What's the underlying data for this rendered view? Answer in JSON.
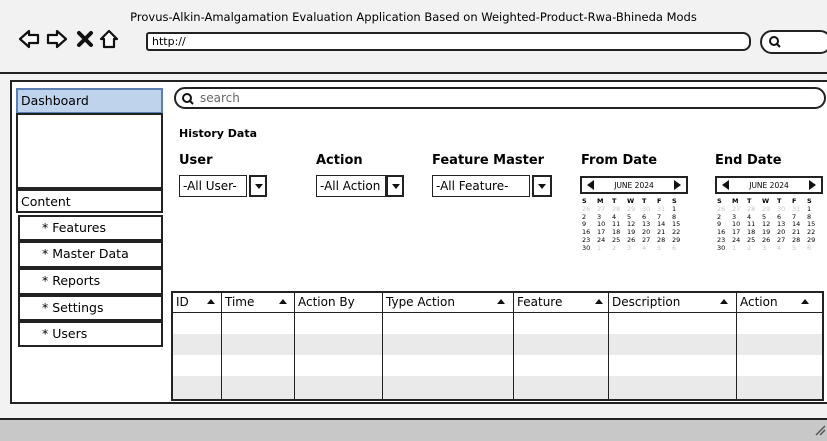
{
  "window": {
    "title": "Provus-Alkin-Amalgamation Evaluation Application Based on Weighted-Product-Rwa-Bhineda Mods",
    "url": "http://"
  },
  "sidebar": {
    "dashboard": "Dashboard",
    "content": "Content",
    "items": [
      "* Features",
      "* Master Data",
      "* Reports",
      "* Settings",
      "* Users"
    ]
  },
  "search": {
    "placeholder": "search"
  },
  "history": {
    "title": "History Data",
    "filters": {
      "user": {
        "label": "User",
        "value": "-All User-"
      },
      "action": {
        "label": "Action",
        "value": "-All Action"
      },
      "feature": {
        "label": "Feature Master",
        "value": "-All Feature-"
      },
      "from_date": {
        "label": "From Date"
      },
      "end_date": {
        "label": "End Date"
      }
    }
  },
  "calendar": {
    "month": "JUNE 2024",
    "weekdays": [
      "S",
      "M",
      "T",
      "W",
      "T",
      "F",
      "S"
    ],
    "days": [
      [
        "26",
        "27",
        "28",
        "29",
        "30",
        "31",
        "1"
      ],
      [
        "2",
        "3",
        "4",
        "5",
        "6",
        "7",
        "8"
      ],
      [
        "9",
        "10",
        "11",
        "12",
        "13",
        "14",
        "15"
      ],
      [
        "16",
        "17",
        "18",
        "19",
        "20",
        "21",
        "22"
      ],
      [
        "23",
        "24",
        "25",
        "26",
        "27",
        "28",
        "29"
      ],
      [
        "30",
        "1",
        "2",
        "3",
        "4",
        "5",
        "6"
      ]
    ],
    "selected": "15",
    "colors": {
      "selected": "#8fb4e0",
      "dim": "#c8c8c8"
    }
  },
  "table": {
    "columns": [
      "ID",
      "Time",
      "Action By",
      "Type Action",
      "Feature",
      "Description",
      "Action"
    ],
    "row_count": 5
  },
  "colors": {
    "dashboard_bg": "#bfd3ec",
    "row_alt": "#eaeaea"
  }
}
